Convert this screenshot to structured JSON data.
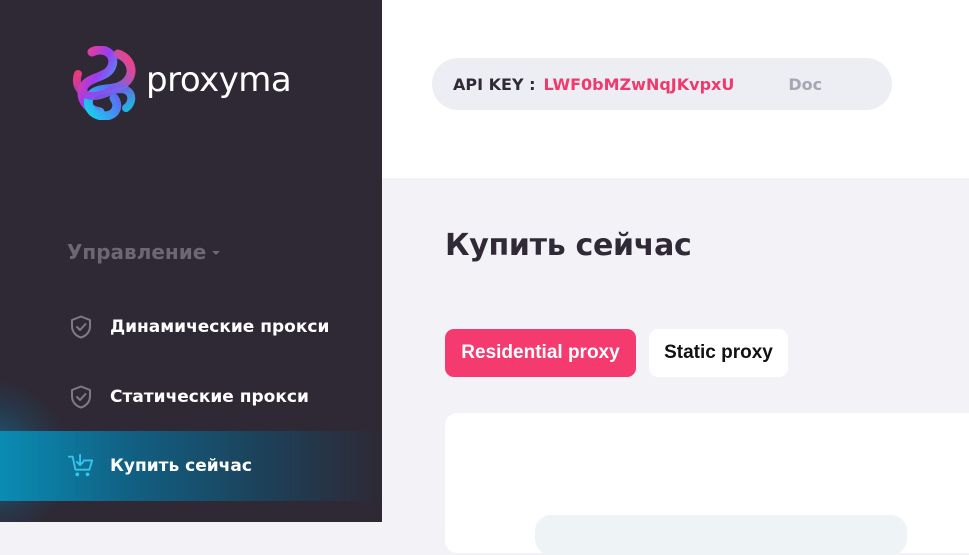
{
  "brand": {
    "name": "proxyma",
    "colors": {
      "sidebar": "#2e2935",
      "accent_pink": "#f43a6f",
      "accent_blue": "#0a8cb3"
    }
  },
  "sidebar": {
    "section_title": "Управление",
    "items": [
      {
        "label": "Динамические прокси",
        "icon": "shield-check-icon",
        "active": false
      },
      {
        "label": "Статические прокси",
        "icon": "shield-check-icon",
        "active": false
      },
      {
        "label": "Купить сейчас",
        "icon": "cart-download-icon",
        "active": true
      }
    ]
  },
  "topbar": {
    "api_key_label": "API KEY :",
    "api_key_value": "LWF0bMZwNqJKvpxU",
    "doc_link": "Doc"
  },
  "main": {
    "title": "Купить сейчас",
    "tabs": [
      {
        "label": "Residential proxy",
        "active": true
      },
      {
        "label": "Static proxy",
        "active": false
      }
    ]
  }
}
